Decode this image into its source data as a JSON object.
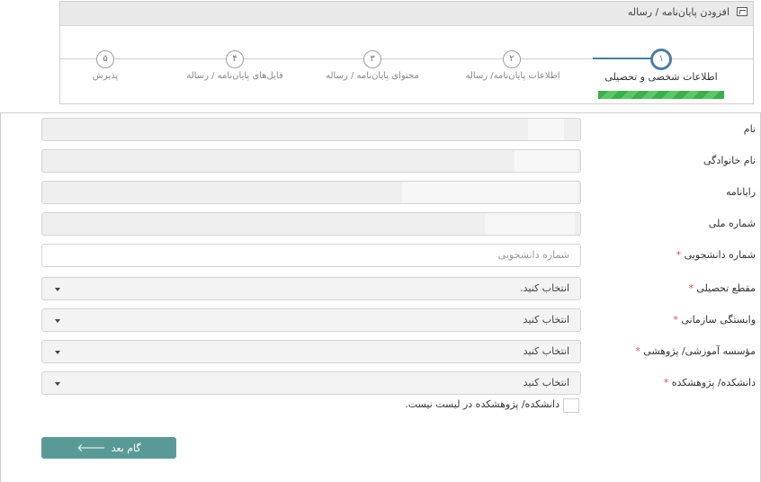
{
  "wizard": {
    "title": "افزودن پایان‌نامه / رساله",
    "steps": [
      {
        "number": "۱",
        "label": "اطلاعات شخصی و تحصیلی",
        "active": true
      },
      {
        "number": "۲",
        "label": "اطلاعات پایان‌نامه/ رساله",
        "active": false
      },
      {
        "number": "۳",
        "label": "محتوای پایان‌نامه / رساله",
        "active": false
      },
      {
        "number": "۴",
        "label": "فایل‌های پایان‌نامه / رساله",
        "active": false
      },
      {
        "number": "۵",
        "label": "پذیرش",
        "active": false
      }
    ]
  },
  "form": {
    "fields": [
      {
        "label": "نام",
        "required": false,
        "type": "readonly"
      },
      {
        "label": "نام خانوادگی",
        "required": false,
        "type": "readonly"
      },
      {
        "label": "رایانامه",
        "required": false,
        "type": "readonly"
      },
      {
        "label": "شماره ملی",
        "required": false,
        "type": "readonly"
      },
      {
        "label": "شماره دانشجویی",
        "required": true,
        "type": "text",
        "placeholder": "شماره دانشجویی"
      },
      {
        "label": "مقطع تحصیلی",
        "required": true,
        "type": "select",
        "value": "انتخاب کنید."
      },
      {
        "label": "وابستگی سازمانی",
        "required": true,
        "type": "select",
        "value": "انتخاب کنید"
      },
      {
        "label": "مؤسسه آموزشی/ پژوهشی",
        "required": true,
        "type": "select",
        "value": "انتخاب کنید"
      },
      {
        "label": "دانشکده/ پژوهشکده",
        "required": true,
        "type": "select",
        "value": "انتخاب کنید"
      }
    ],
    "checkbox_label": "دانشکده/ پژوهشکده در لیست نیست.",
    "required_mark": "*",
    "next_button": "گام بعد"
  },
  "colors": {
    "accent": "#4a7fa3",
    "progress": "#3bb04a",
    "button": "#5a9a96",
    "required": "#d9534f"
  }
}
